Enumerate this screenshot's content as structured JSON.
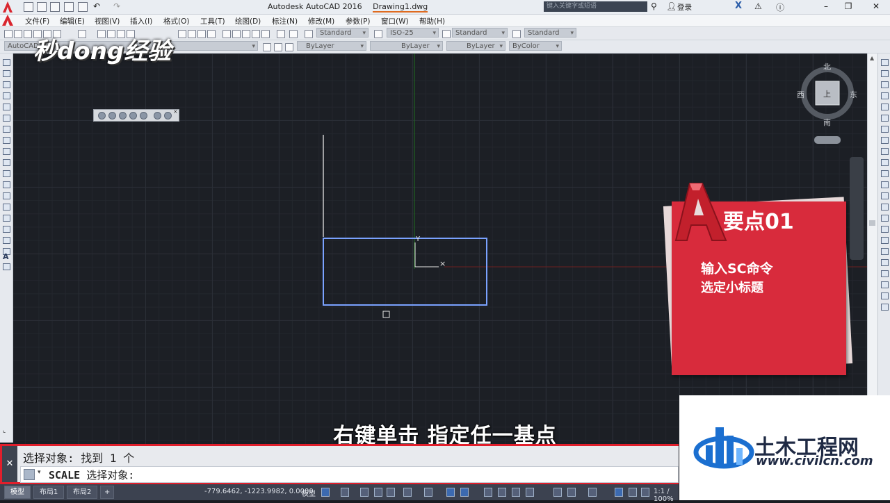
{
  "window": {
    "app_title": "Autodesk AutoCAD 2016",
    "document": "Drawing1.dwg",
    "search_placeholder": "键入关键字或短语",
    "login": "登录"
  },
  "menu": [
    "文件(F)",
    "编辑(E)",
    "视图(V)",
    "插入(I)",
    "格式(O)",
    "工具(T)",
    "绘图(D)",
    "标注(N)",
    "修改(M)",
    "参数(P)",
    "窗口(W)",
    "帮助(H)"
  ],
  "toolbar1": {
    "text_style": "Standard",
    "dim_style": "ISO-25",
    "table_style": "Standard",
    "mleader_style": "Standard"
  },
  "toolbar2": {
    "workspace": "AutoCAD",
    "layer": "ByLayer",
    "linetype": "ByLayer",
    "lineweight": "ByLayer",
    "color": "ByColor"
  },
  "viewcube": {
    "north": "北",
    "south": "南",
    "east": "东",
    "west": "西",
    "face": "上"
  },
  "callout": {
    "heading": "要点01",
    "line1": "输入SC命令",
    "line2": "选定小标题"
  },
  "caption": "右键单击 指定任一基点",
  "command": {
    "history": "选择对象: 找到 1 个",
    "prompt_cmd": "SCALE",
    "prompt_text": "选择对象:"
  },
  "status": {
    "tabs": [
      "模型",
      "布局1",
      "布局2"
    ],
    "add_tab": "+",
    "coords": "-779.6462, -1223.9982, 0.0000",
    "model": "模型",
    "scale": "1:1 / 100%"
  },
  "watermark": {
    "site_logo": "秒dong经验",
    "civil_name": "土木工程网",
    "civil_url": "www.civilcn.com"
  }
}
